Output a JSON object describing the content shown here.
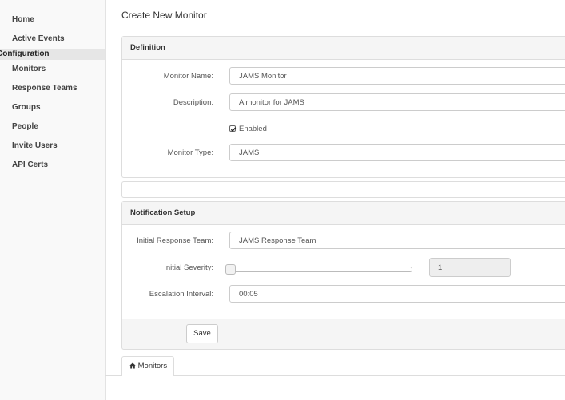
{
  "sidebar": {
    "items": [
      {
        "label": "Home"
      },
      {
        "label": "Active Events"
      },
      {
        "label": "Monitors"
      },
      {
        "label": "Response Teams"
      },
      {
        "label": "Groups"
      },
      {
        "label": "People"
      },
      {
        "label": "Invite Users"
      },
      {
        "label": "API Certs"
      }
    ],
    "section_label": "Configuration"
  },
  "page": {
    "title": "Create New Monitor"
  },
  "definition": {
    "heading": "Definition",
    "monitor_name_label": "Monitor Name:",
    "monitor_name_value": "JAMS Monitor",
    "description_label": "Description:",
    "description_value": "A monitor for JAMS",
    "enabled_label": "Enabled",
    "enabled_checked": true,
    "monitor_type_label": "Monitor Type:",
    "monitor_type_value": "JAMS"
  },
  "notification": {
    "heading": "Notification Setup",
    "initial_team_label": "Initial Response Team:",
    "initial_team_value": "JAMS Response Team",
    "severity_label": "Initial Severity:",
    "severity_value": "1",
    "escalation_label": "Escalation Interval:",
    "escalation_value": "00:05"
  },
  "actions": {
    "save_label": "Save"
  },
  "tabs": {
    "monitors_icon": "home-icon",
    "monitors_label": "Monitors"
  },
  "colors": {
    "sidebar_bg": "#f9f9f9",
    "panel_head_bg": "#f5f5f5",
    "border": "#dddddd"
  }
}
